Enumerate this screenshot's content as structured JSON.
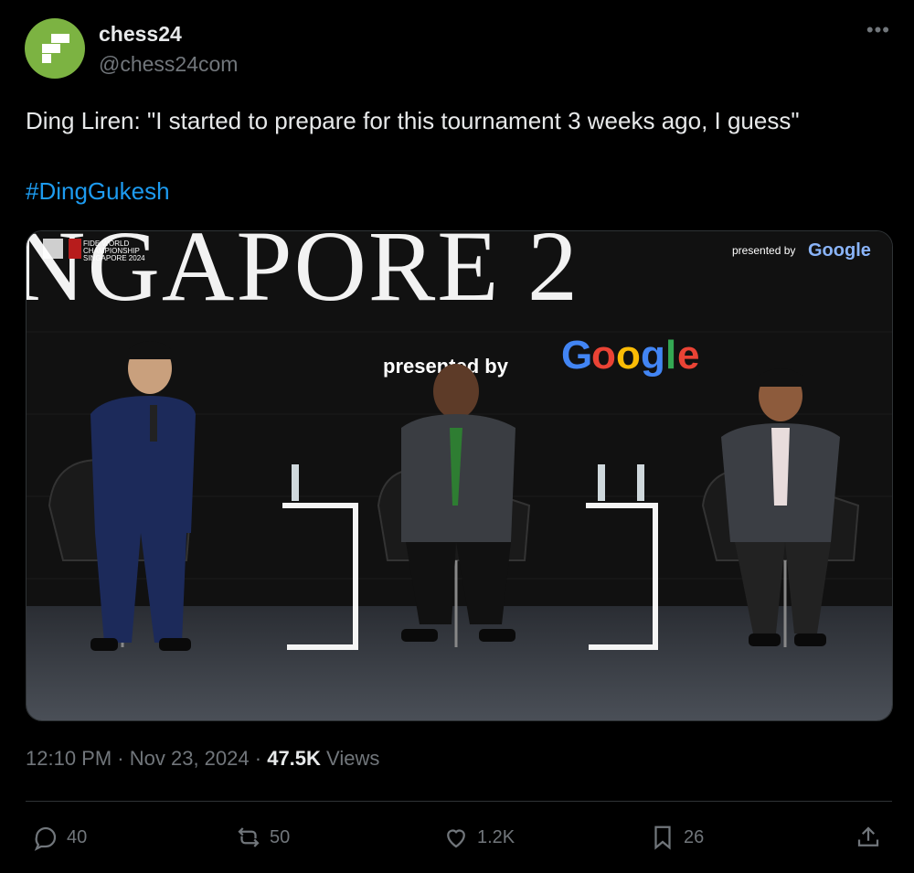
{
  "author": {
    "name": "chess24",
    "handle": "@chess24com"
  },
  "tweet": {
    "text": "Ding Liren: \"I started to prepare for this tournament 3 weeks ago, I guess\"",
    "hashtag": "#DingGukesh"
  },
  "media": {
    "banner_text": "NGAPORE 2",
    "presented_by": "presented by",
    "brand": "Google",
    "corner_event_line1": "FIDE WORLD",
    "corner_event_line2": "CHAMPIONSHIP",
    "corner_event_line3": "SINGAPORE 2024",
    "corner_presented": "presented by",
    "corner_brand": "Google"
  },
  "meta": {
    "time": "12:10 PM",
    "date": "Nov 23, 2024",
    "views_count": "47.5K",
    "views_label": "Views"
  },
  "actions": {
    "replies": "40",
    "reposts": "50",
    "likes": "1.2K",
    "bookmarks": "26"
  },
  "icons": [
    "reply-icon",
    "repost-icon",
    "like-icon",
    "bookmark-icon",
    "share-icon",
    "more-icon"
  ]
}
